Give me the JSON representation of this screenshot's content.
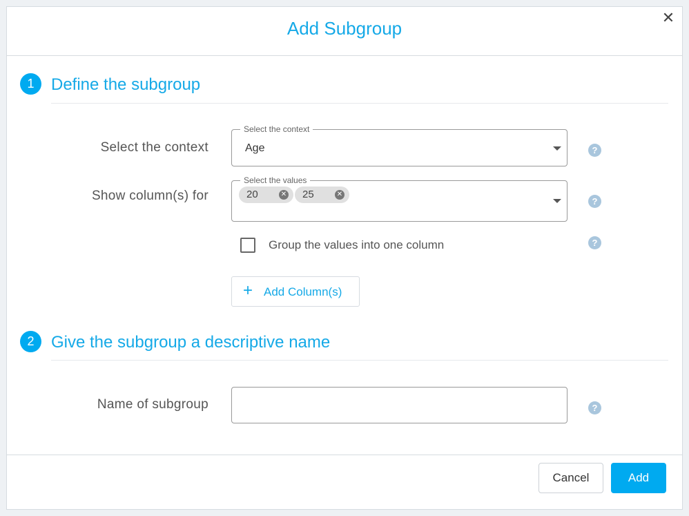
{
  "dialog": {
    "title": "Add Subgroup",
    "close_glyph": "✕"
  },
  "steps": [
    {
      "number": "1",
      "title": "Define the subgroup"
    },
    {
      "number": "2",
      "title": "Give the subgroup a descriptive name"
    }
  ],
  "context": {
    "label": "Select the context",
    "legend": "Select the context",
    "value": "Age"
  },
  "values": {
    "label": "Show column(s) for",
    "legend": "Select the values",
    "chips": [
      "20",
      "25"
    ]
  },
  "group_checkbox": {
    "label": "Group the values into one column",
    "checked": false
  },
  "add_columns_button": {
    "label": "Add Column(s)",
    "icon": "plus-icon"
  },
  "name_field": {
    "label": "Name of subgroup",
    "value": ""
  },
  "help_glyph": "?",
  "footer": {
    "cancel_label": "Cancel",
    "add_label": "Add"
  },
  "colors": {
    "accent": "#00aaf0",
    "title": "#15a9e7",
    "help": "#a9c6dd"
  }
}
